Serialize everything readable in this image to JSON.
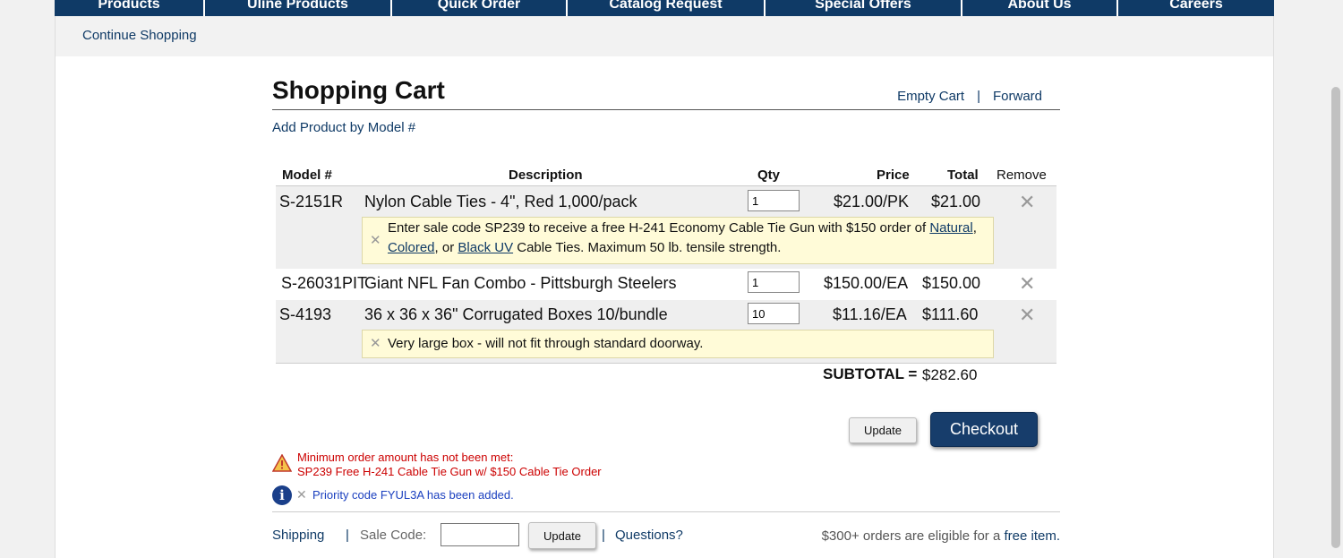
{
  "nav": {
    "items": [
      {
        "label": "Products"
      },
      {
        "label": "Uline Products"
      },
      {
        "label": "Quick Order"
      },
      {
        "label": "Catalog Request"
      },
      {
        "label": "Special Offers"
      },
      {
        "label": "About Us"
      },
      {
        "label": "Careers"
      }
    ]
  },
  "subnav": {
    "continue_label": "Continue Shopping"
  },
  "cart": {
    "title": "Shopping Cart",
    "empty_cart_label": "Empty Cart",
    "separator": "|",
    "forward_label": "Forward",
    "add_product_label": "Add Product by Model #",
    "columns": {
      "model": "Model #",
      "description": "Description",
      "qty": "Qty",
      "price": "Price",
      "total": "Total",
      "remove": "Remove"
    },
    "items": [
      {
        "model": "S-2151R",
        "description": "Nylon Cable Ties - 4\", Red 1,000/pack",
        "qty": "1",
        "price": "$21.00/PK",
        "total": "$21.00",
        "remove": "✕",
        "note": {
          "close": "✕",
          "text_before": "Enter sale code SP239 to receive a free H-241 Economy Cable Tie Gun with $150 order of",
          "link1": "Natural",
          "comma": ",",
          "link2": "Colored",
          "or_text": ", or",
          "link3": "Black UV",
          "text_after": "Cable Ties. Maximum 50 lb. tensile strength."
        }
      },
      {
        "model": "S-26031PIT",
        "description": "Giant NFL Fan Combo - Pittsburgh Steelers",
        "qty": "1",
        "price": "$150.00/EA",
        "total": "$150.00",
        "remove": "✕"
      },
      {
        "model": "S-4193",
        "description": "36 x 36 x 36\" Corrugated Boxes 10/bundle",
        "qty": "10",
        "price": "$11.16/EA",
        "total": "$111.60",
        "remove": "✕",
        "note": {
          "close": "✕",
          "text": "Very large box - will not fit through standard doorway."
        }
      }
    ],
    "subtotal_label": "SUBTOTAL =",
    "subtotal_value": "$282.60",
    "update_label": "Update",
    "checkout_label": "Checkout"
  },
  "messages": {
    "warning_line1": "Minimum order amount has not been met:",
    "warning_line2": "SP239 Free H-241 Cable Tie Gun w/ $150 Cable Tie Order",
    "info_close": "✕",
    "info_text": "Priority code FYUL3A has been added.",
    "warning_color": "#cc0000",
    "info_color": "#1a3fbf"
  },
  "footer": {
    "shipping_label": "Shipping",
    "separator": "|",
    "sale_code_label": "Sale Code:",
    "sale_code_value": "",
    "update_label": "Update",
    "questions_label": "Questions?",
    "promo_text": "$300+ orders are eligible for a",
    "promo_link": "free item."
  },
  "colors": {
    "nav_bg": "#0f3a66",
    "link": "#0f3a66",
    "checkout_bg": "#173d6b",
    "note_bg": "#fffbd8",
    "row_shade": "#efefef"
  }
}
